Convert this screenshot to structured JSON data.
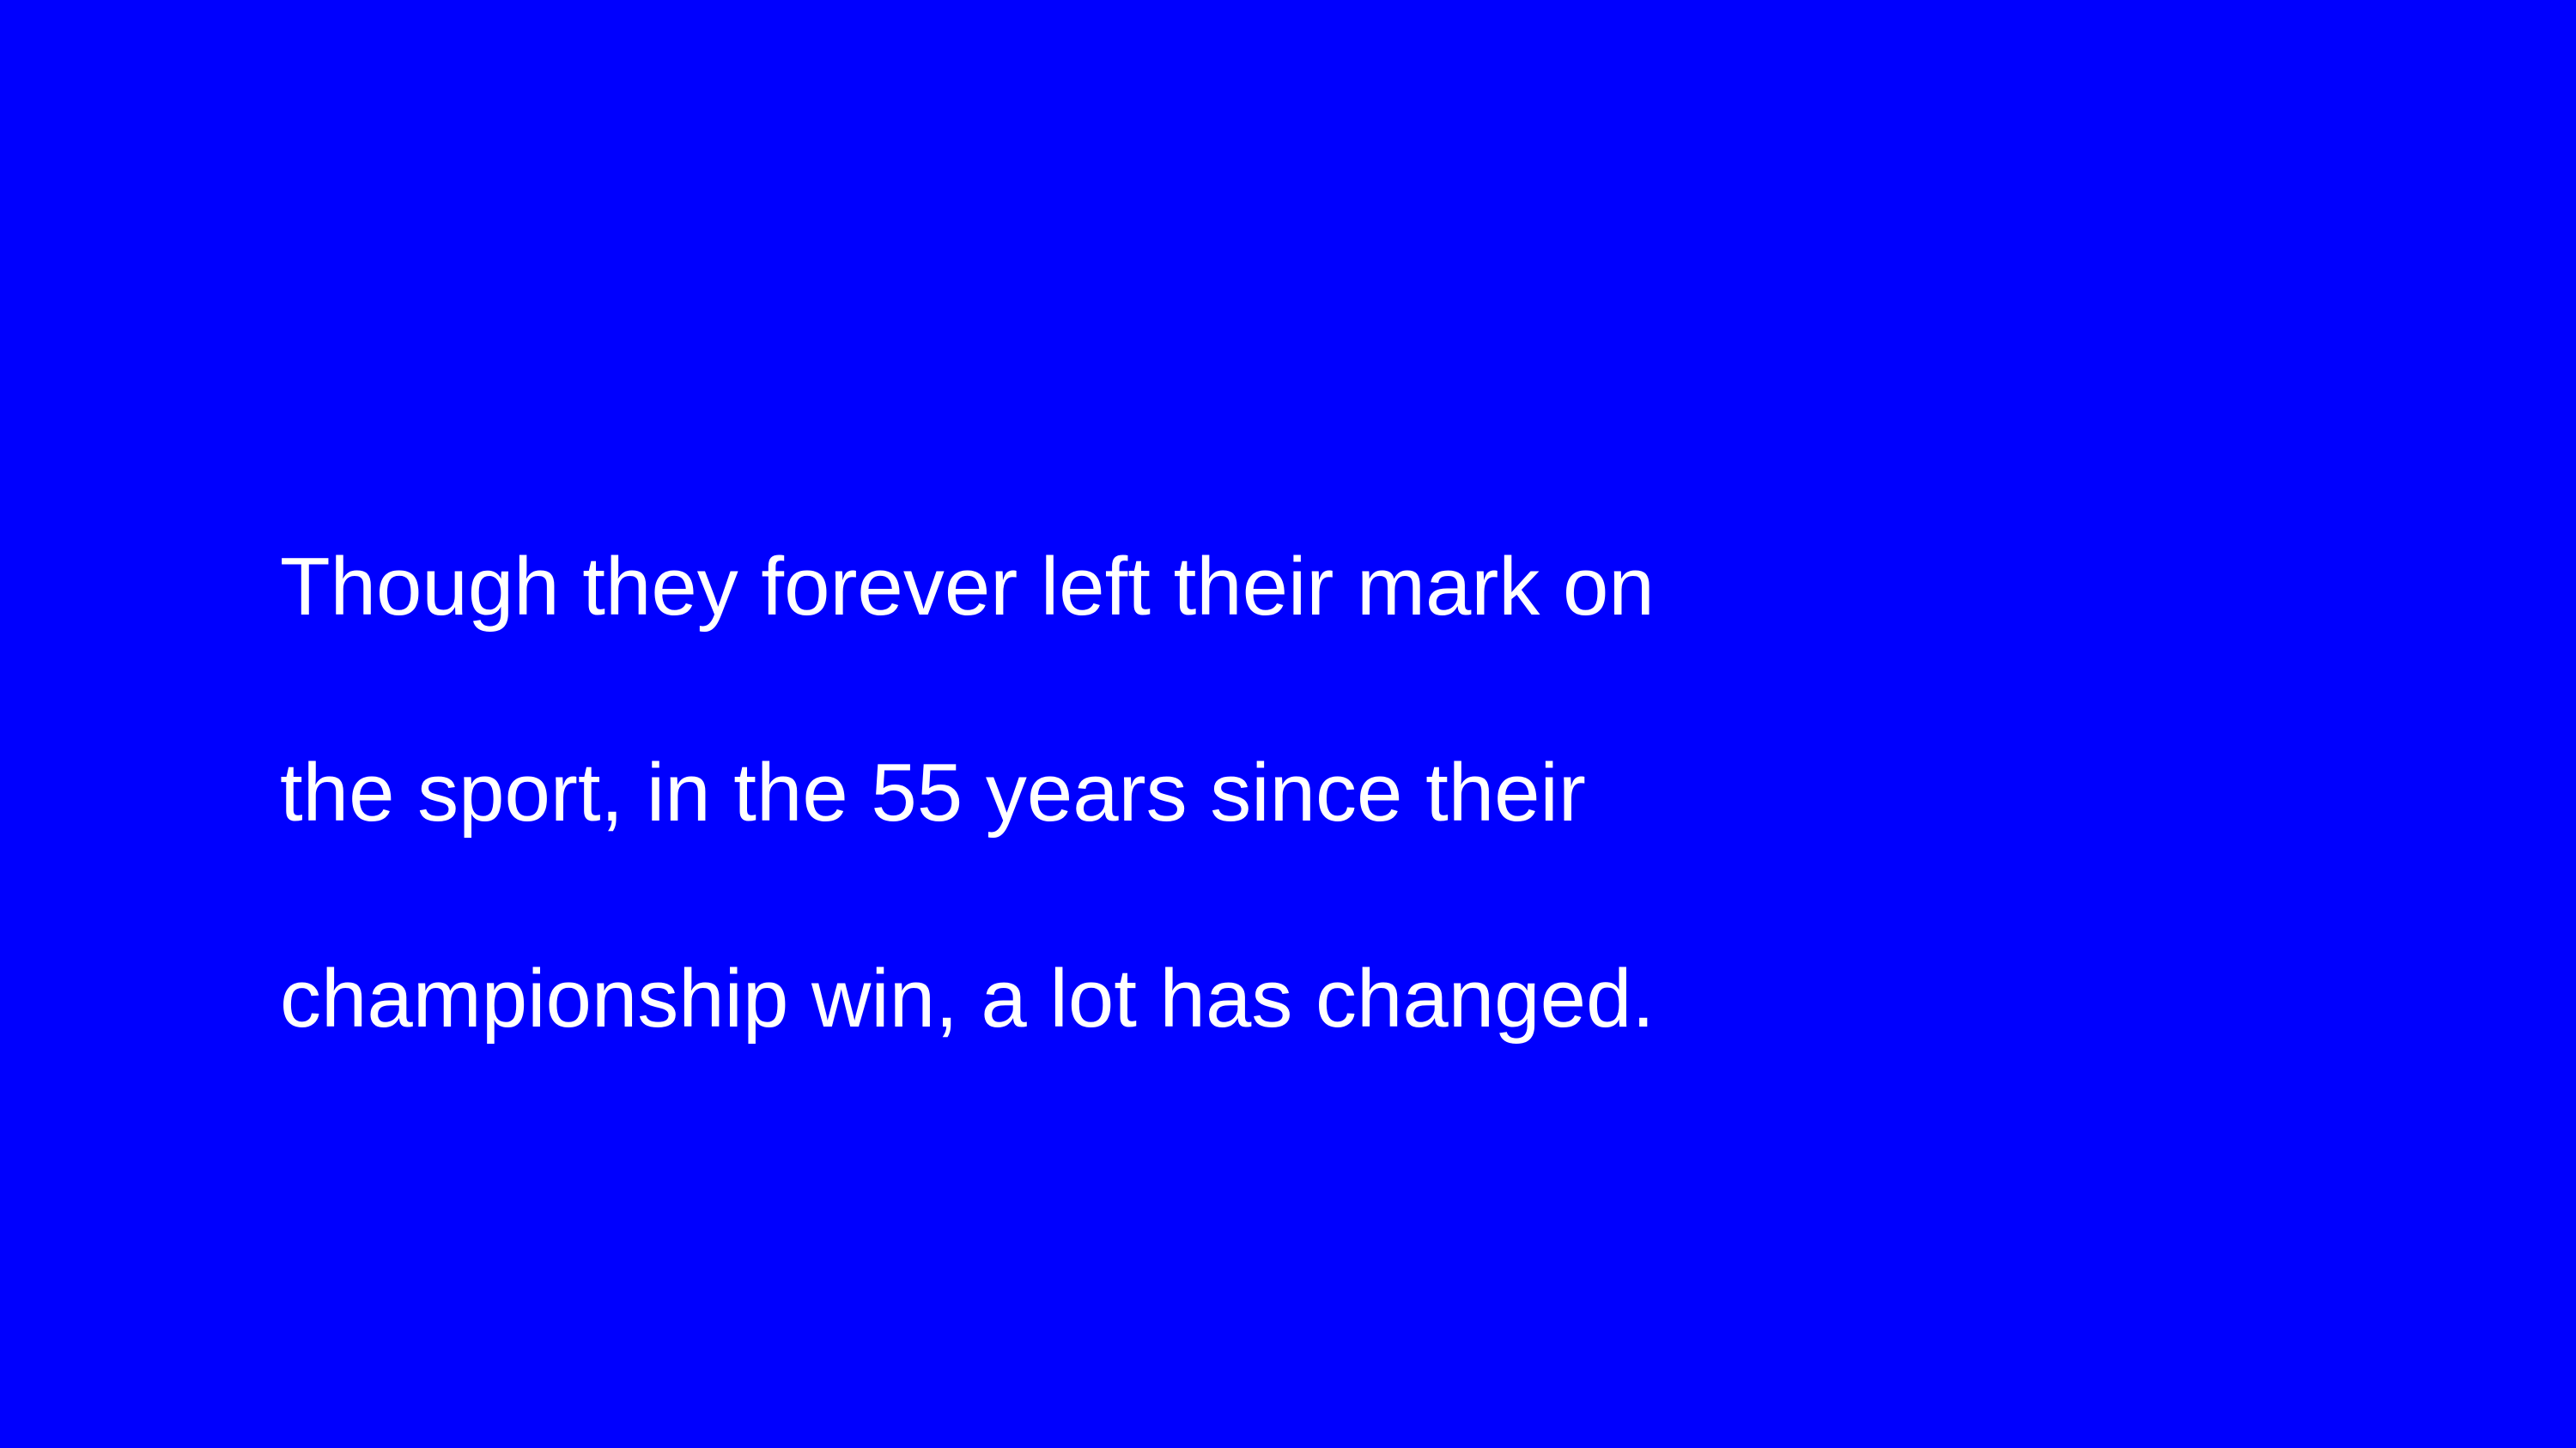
{
  "slide": {
    "background_color": "#0000fe",
    "text_color": "#ffffff",
    "lines": [
      "Though they forever left their mark on",
      "the sport, in the 55 years since their",
      "championship win, a lot has changed."
    ]
  }
}
